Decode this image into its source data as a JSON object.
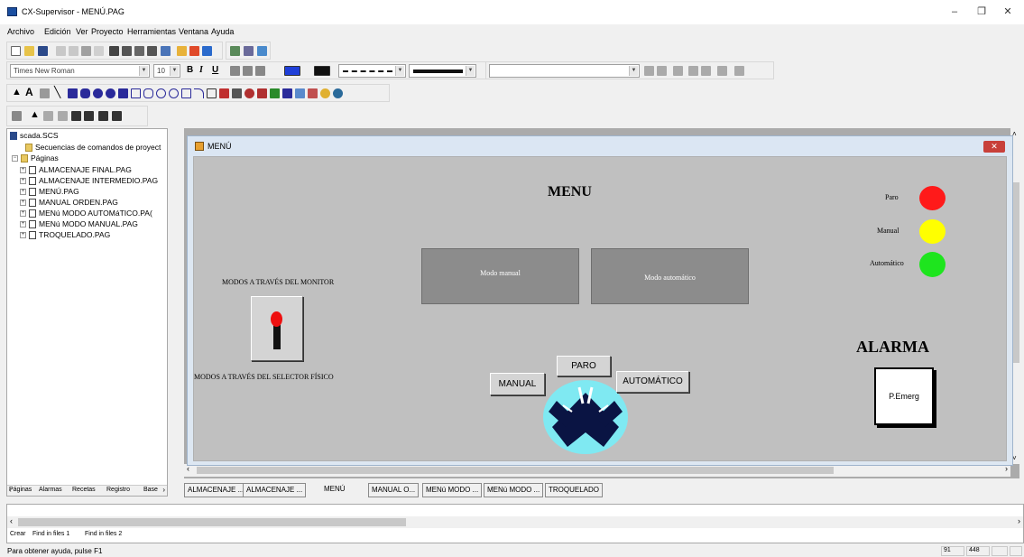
{
  "window": {
    "title": "CX-Supervisor - MENÚ.PAG",
    "minimize": "–",
    "maximize": "❐",
    "close": "✕"
  },
  "menubar": {
    "items": [
      "Archivo",
      "Edición",
      "Ver",
      "Proyecto",
      "Herramientas",
      "Ventana",
      "Ayuda"
    ]
  },
  "format_toolbar": {
    "font_value": "Times New Roman",
    "size_value": "10",
    "bold": "B",
    "italic": "I",
    "underline": "U"
  },
  "project_tree": {
    "root": "scada.SCS",
    "items": [
      {
        "label": "Secuencias de comandos de proyect",
        "kind": "folder"
      },
      {
        "label": "Páginas",
        "kind": "pages"
      },
      {
        "label": "ALMACENAJE FINAL.PAG",
        "kind": "page"
      },
      {
        "label": "ALMACENAJE INTERMEDIO.PAG",
        "kind": "page"
      },
      {
        "label": "MENÚ.PAG",
        "kind": "page"
      },
      {
        "label": "MANUAL ORDEN.PAG",
        "kind": "page"
      },
      {
        "label": "MENú MODO AUTOMáTICO.PA(",
        "kind": "page"
      },
      {
        "label": "MENú MODO MANUAL.PAG",
        "kind": "page"
      },
      {
        "label": "TROQUELADO.PAG",
        "kind": "page"
      }
    ],
    "bottom_tabs": [
      "Páginas",
      "Alarmas",
      "Recetas",
      "Registro",
      "Base"
    ]
  },
  "child_window": {
    "title": "MENÚ",
    "close": "✕"
  },
  "canvas": {
    "heading": "MENU",
    "monitor_label": "MODOS A TRAVÉS DEL MONITOR",
    "selector_label": "MODOS A TRAVÉS DEL SELECTOR FÍSICO",
    "mode_manual": "Modo manual",
    "mode_auto": "Modo automático",
    "btn_paro": "PARO",
    "btn_manual": "MANUAL",
    "btn_auto": "AUTOMÁTICO",
    "lamps": [
      {
        "label": "Paro",
        "color": "#ff1a1a"
      },
      {
        "label": "Manual",
        "color": "#ffff00"
      },
      {
        "label": "Automático",
        "color": "#1ee51e"
      }
    ],
    "alarm_title": "ALARMA",
    "emergency_button": "P.Emerg"
  },
  "doc_tabs": [
    "ALMACENAJE ...",
    "ALMACENAJE ...",
    "MENÚ",
    "MANUAL O...",
    "MENú MODO ...",
    "MENú MODO ...",
    "TROQUELADO"
  ],
  "active_doc_tab": "MENÚ",
  "output_tabs": [
    "Crear",
    "Find in files 1",
    "Find in files 2"
  ],
  "status": {
    "help": "Para obtener ayuda, pulse F1",
    "x": "91",
    "y": "448"
  },
  "colors": {
    "canvas_bg": "#c0c0c0",
    "selector_knob": "#0a1443",
    "selector_ring": "#7fe9f2"
  }
}
